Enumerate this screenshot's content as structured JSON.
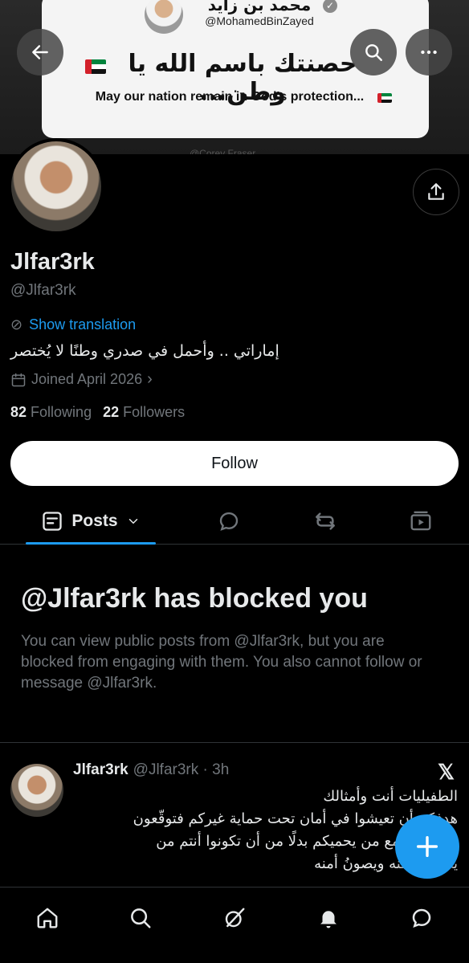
{
  "banner": {
    "name": "محمد بن زايد",
    "handle": "@MohamedBinZayed",
    "arabic_text": "حصنتك باسم الله يا وطن...",
    "english_text": "May our nation remain in God's protection...",
    "credit": "@Corey Fraser"
  },
  "profile": {
    "display_name": "Jlfar3rk",
    "handle": "@Jlfar3rk",
    "show_translation": "Show translation",
    "bio": "إماراتي .. وأحمل في صدري وطنًا لا يُختصر",
    "joined": "Joined April 2026",
    "following_count": "82",
    "following_label": "Following",
    "followers_count": "22",
    "followers_label": "Followers",
    "follow_button": "Follow"
  },
  "tabs": {
    "active": "Posts"
  },
  "blocked": {
    "title": "@Jlfar3rk has blocked you",
    "message": "You can view public posts from @Jlfar3rk, but you are blocked from engaging with them. You also cannot follow or message @Jlfar3rk."
  },
  "post": {
    "name": "Jlfar3rk",
    "meta": "@Jlfar3rk · 3h",
    "lines": [
      "الطفيليات أنت وأمثالك",
      "هدفكم أن تعيشوا في أمان تحت حماية غيركم فتوقّعون",
      "الصفقات مع من يحميكم بدلًا من أن تكونوا أنتم من",
      "يحمي وطنه ويصونُ أمنه"
    ]
  },
  "colors": {
    "accent": "#1d9bf0",
    "background": "#000000",
    "muted": "#71767b",
    "text": "#e7e9ea"
  },
  "icons": {
    "back": "arrow-left-icon",
    "search": "search-icon",
    "more": "more-icon",
    "share": "share-icon",
    "home": "home-icon",
    "explore": "search-icon",
    "grok": "grok-icon",
    "notifications": "bell-icon",
    "messages": "message-icon"
  }
}
